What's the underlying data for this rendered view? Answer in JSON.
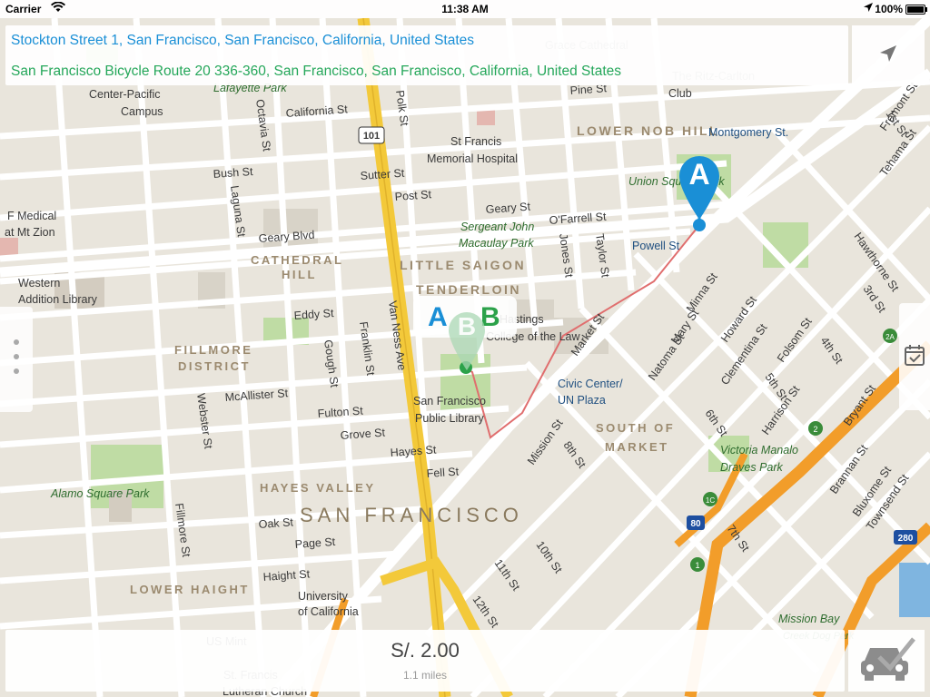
{
  "status_bar": {
    "carrier": "Carrier",
    "time": "11:38 AM",
    "battery": "100%"
  },
  "route": {
    "origin": "Stockton Street 1, San Francisco, San Francisco, California, United States",
    "destination": "San Francisco Bicycle Route 20 336-360, San Francisco, San Francisco, California, United States"
  },
  "markers": {
    "label_a": "A",
    "label_b": "B",
    "pin_a": "A",
    "pin_b": "B"
  },
  "fare": {
    "price": "S/. 2.00",
    "distance": "1.1 miles"
  },
  "colors": {
    "origin": "#1a8fd6",
    "destination": "#25a75a",
    "highway": "#f3c93a",
    "freeway": "#f29d2a",
    "route": "#e06e6e"
  },
  "icons": {
    "locate": "navigation-arrow-icon",
    "calendar": "calendar-check-icon",
    "car": "car-check-icon",
    "wifi": "wifi-icon",
    "location": "location-arrow-icon"
  },
  "map": {
    "neighborhoods": [
      "LOWER NOB HILL",
      "CATHEDRAL HILL",
      "LITTLE SAIGON",
      "TENDERLOIN",
      "FILLMORE DISTRICT",
      "SOUTH OF MARKET",
      "HAYES VALLEY",
      "LOWER HAIGHT"
    ],
    "city": "SAN FRANCISCO",
    "streets": [
      "California St",
      "Pine St",
      "Bush St",
      "Sutter St",
      "Post St",
      "Geary St",
      "Geary Blvd",
      "O'Farrell St",
      "Eddy St",
      "Fulton St",
      "McAllister St",
      "Grove St",
      "Hayes St",
      "Fell St",
      "Oak St",
      "Page St",
      "Haight St",
      "Van Ness Ave",
      "Franklin St",
      "Gough St",
      "Laguna St",
      "Octavia St",
      "Polk St",
      "Jones St",
      "Taylor St",
      "Webster St",
      "Fillmore St",
      "Market St",
      "Mission St",
      "Howard St",
      "Folsom St",
      "Harrison St",
      "Bryant St",
      "Brannan St",
      "Townsend St",
      "Bluxome St",
      "Minna St",
      "Mary St",
      "Natoma St",
      "Clementina St",
      "Montgomery St",
      "Tehama St",
      "Hawthorne St",
      "Fremont St",
      "1st St",
      "3rd St",
      "4th St",
      "5th St",
      "6th St",
      "7th St",
      "8th St",
      "10th St",
      "11th St",
      "12th St"
    ],
    "places": [
      "Grace Cathedral",
      "The Ritz-Carlton Club",
      "Center-Pacific Campus",
      "Lafayette Park",
      "St Francis Memorial Hospital",
      "F Medical at Mt Zion",
      "Western Addition Library",
      "Sergeant John Macaulay Park",
      "Union Square Park",
      "Powell St",
      "Civic Center/ UN Plaza",
      "San Francisco Public Library",
      "Hastings College of the Law",
      "Victoria Manalo Draves Park",
      "Alamo Square Park",
      "University of California",
      "Mission Bay Creek Dog Park",
      "US Mint",
      "St. Francis Lutheran Church"
    ],
    "shields": [
      "101",
      "80",
      "280",
      "1",
      "2",
      "1C",
      "2A"
    ]
  }
}
